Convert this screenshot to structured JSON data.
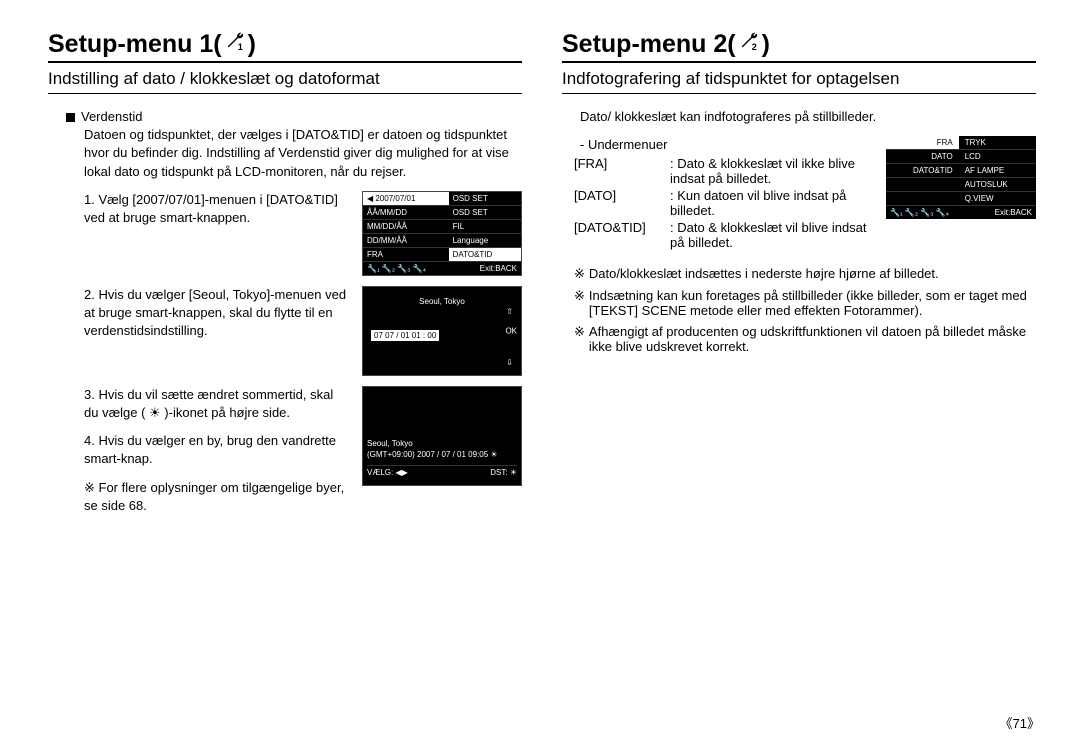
{
  "left": {
    "title_prefix": "Setup-menu 1( ",
    "title_suffix": " )",
    "section": "Indstilling af dato / klokkeslæt og datoformat",
    "worldtime_label": "Verdenstid",
    "worldtime_desc": "Datoen og tidspunktet, der vælges i [DATO&TID] er datoen og tidspunktet hvor du befinder dig. Indstilling af Verdenstid giver dig mulighed for at vise lokal dato og tidspunkt på LCD-monitoren, når du rejser.",
    "step1": "1. Vælg [2007/07/01]-menuen i [DATO&TID] ved at bruge smart-knappen.",
    "step2": "2. Hvis du vælger [Seoul, Tokyo]-menuen ved at bruge smart-knappen, skal du flytte til en verdenstidsindstilling.",
    "step3": "3. Hvis du vil sætte ændret sommertid, skal du vælge ( ☀ )-ikonet på højre side.",
    "step4": "4. Hvis du vælger en by, brug den vandrette smart-knap.",
    "note": "※ For flere oplysninger om tilgængelige byer, se side 68.",
    "panel1": {
      "r1l": "◀  2007/07/01",
      "r1r": "OSD SET",
      "r2l": "ÅÅ/MM/DD",
      "r2r": "OSD SET",
      "r3l": "MM/DD/ÅÅ",
      "r3r": "FIL",
      "r4l": "DD/MM/ÅÅ",
      "r4r": "Language",
      "r5l": "FRA",
      "r5r": "DATO&TID",
      "footer_right": "Exit:BACK"
    },
    "panel2": {
      "city": "Seoul, Tokyo",
      "date": "07  07 / 01  01 : 00",
      "ok": "OK"
    },
    "panel3": {
      "city": "Seoul, Tokyo",
      "gmt": "(GMT+09:00) 2007 / 07 / 01 09:05  ☀",
      "left": "VÆLG: ◀▶",
      "right": "DST: ☀"
    }
  },
  "right": {
    "title_prefix": "Setup-menu 2( ",
    "title_suffix": " )",
    "section": "Indfotografering af tidspunktet for optagelsen",
    "intro": "Dato/ klokkeslæt kan indfotograferes på stillbilleder.",
    "sub_label": "- Undermenuer",
    "rows": [
      {
        "lbl": "[FRA]",
        "desc": ": Dato & klokkeslæt vil ikke blive indsat på billedet."
      },
      {
        "lbl": "[DATO]",
        "desc": ": Kun datoen vil blive indsat på billedet."
      },
      {
        "lbl": "[DATO&TID]",
        "desc": ": Dato & klokkeslæt vil blive indsat på billedet."
      }
    ],
    "panel": {
      "r1l": "FRA",
      "r1r": "TRYK",
      "r2l": "DATO",
      "r2r": "LCD",
      "r3l": "DATO&TID",
      "r3r": "AF LAMPE",
      "r4r": "AUTOSLUK",
      "r5r": "Q.VIEW",
      "footer_right": "Exit:BACK"
    },
    "notes": [
      "Dato/klokkeslæt indsættes i nederste højre hjørne af billedet.",
      "Indsætning kan kun foretages på stillbilleder (ikke billeder, som er taget med [TEKST] SCENE metode eller med effekten Fotorammer).",
      "Afhængigt af producenten og udskriftfunktionen vil datoen på billedet måske ikke blive udskrevet korrekt."
    ]
  },
  "page_number": "《71》"
}
